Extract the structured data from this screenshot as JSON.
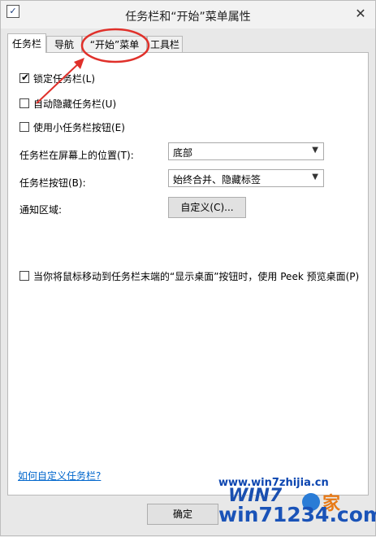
{
  "window": {
    "title": "任务栏和“开始”菜单属性",
    "close_glyph": "✕",
    "app_icon_glyph": "✓"
  },
  "tabs": [
    "任务栏",
    "导航",
    "“开始”菜单",
    "工具栏"
  ],
  "checkboxes": [
    {
      "label": "锁定任务栏(L)",
      "checked": true
    },
    {
      "label": "自动隐藏任务栏(U)",
      "checked": false
    },
    {
      "label": "使用小任务栏按钮(E)",
      "checked": false
    }
  ],
  "position": {
    "label": "任务栏在屏幕上的位置(T):",
    "value": "底部"
  },
  "buttons_setting": {
    "label": "任务栏按钮(B):",
    "value": "始终合并、隐藏标签"
  },
  "notify": {
    "label": "通知区域:",
    "button": "自定义(C)..."
  },
  "peek": {
    "label": "当你将鼠标移动到任务栏末端的“显示桌面”按钮时，使用 Peek 预览桌面(P)",
    "checked": false
  },
  "help_link": "如何自定义任务栏?",
  "ok_button": "确定",
  "watermark": {
    "url": "www.win7zhijia.cn",
    "main": "win71234.com",
    "logo_text": "WIN7",
    "logo_suffix": "家"
  },
  "colors": {
    "annotation": "#e0302a",
    "link": "#0066cc",
    "watermark": "#1a53b8"
  }
}
